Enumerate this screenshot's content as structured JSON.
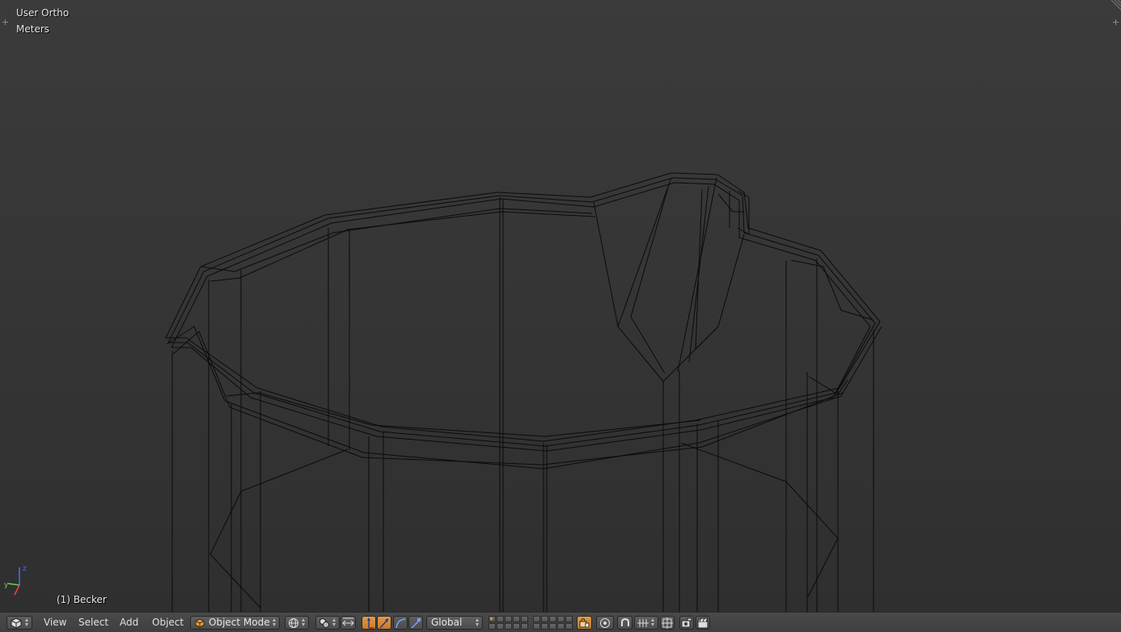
{
  "viewport": {
    "view_name": "User Ortho",
    "units": "Meters",
    "object_name": "(1) Becker"
  },
  "header": {
    "editor_type_icon": "3d-view-cube-icon",
    "menus": [
      "View",
      "Select",
      "Add",
      "Object"
    ],
    "mode": "Object Mode",
    "mode_icon": "object-cube-icon",
    "viewport_shading_icon": "wireframe-sphere-icon",
    "pivot_icon": "pivot-point-icon",
    "manipulator_icons": [
      "manipulator-toggle-icon",
      "translate-icon",
      "rotate-icon",
      "scale-icon"
    ],
    "orientation": "Global",
    "snap_icons": [
      "lock-layers-icon",
      "proportional-edit-icon",
      "snap-magnet-icon",
      "snap-element-icon"
    ],
    "render_icons": [
      "opengl-render-icon",
      "opengl-animation-icon"
    ]
  },
  "colors": {
    "viewport_top": "#3b3b3b",
    "viewport_bottom": "#2f2f2f",
    "header_bg": "#444444",
    "active_button": "#d58a3a",
    "wire": "#0a0a0a"
  }
}
